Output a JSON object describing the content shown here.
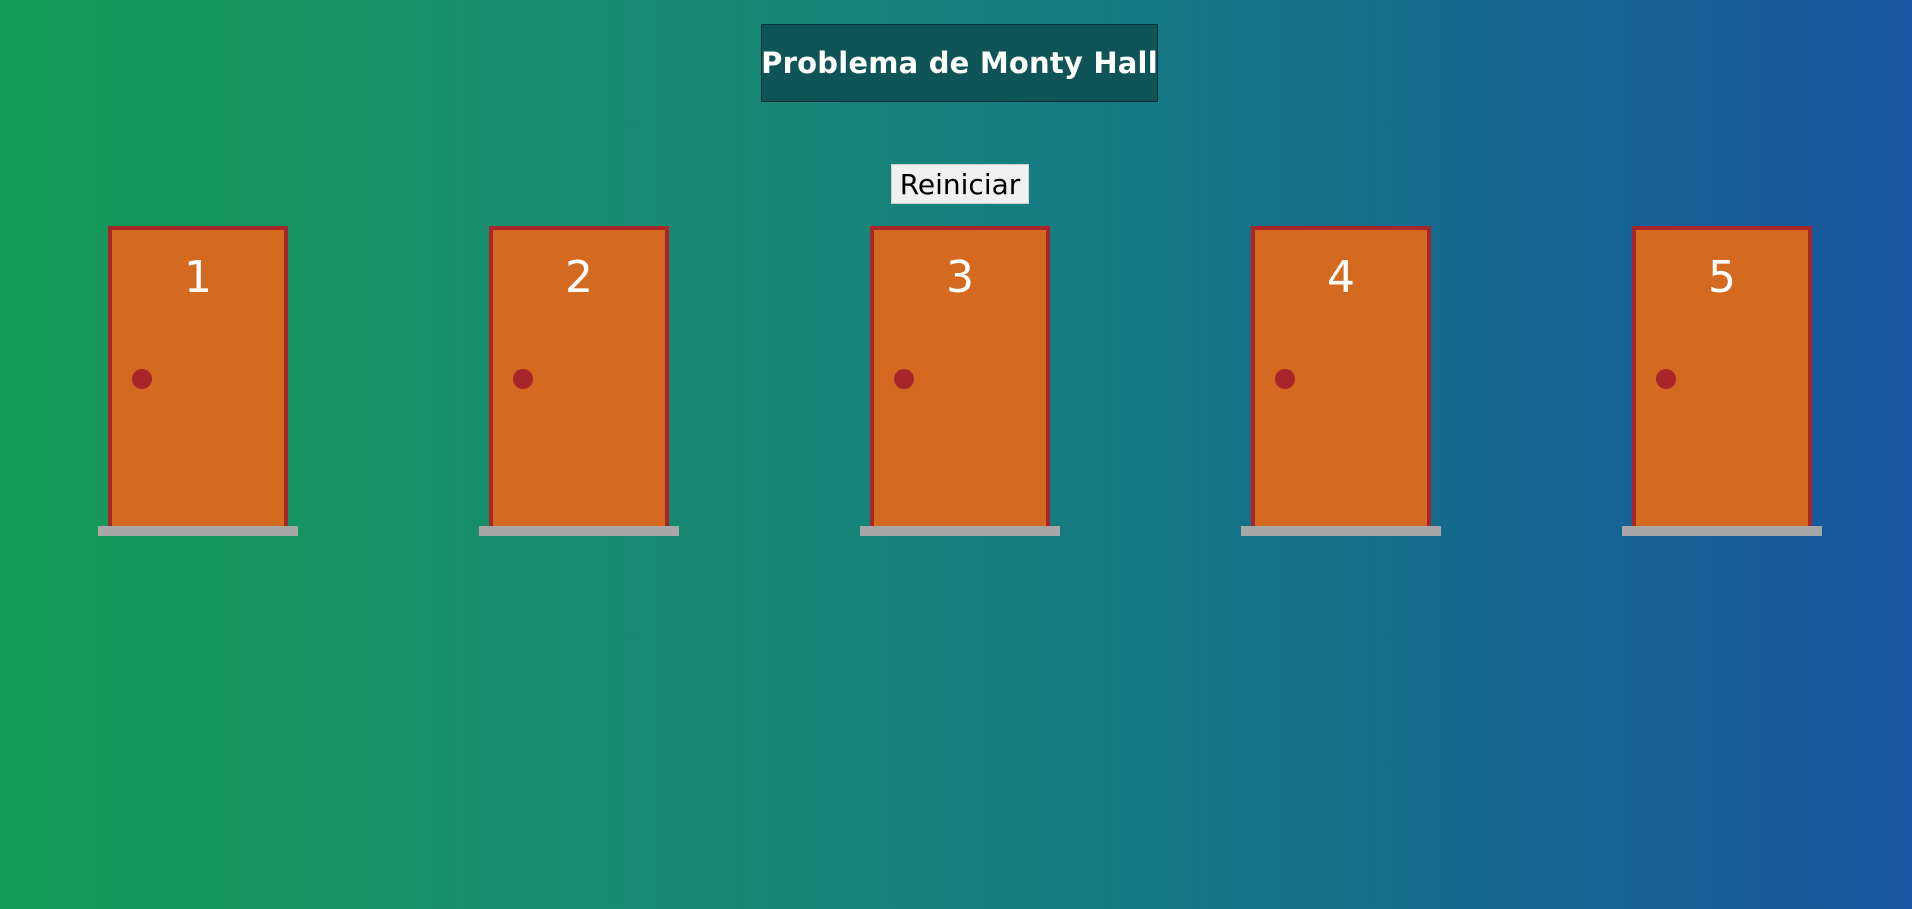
{
  "header": {
    "title": "Problema de Monty Hall"
  },
  "controls": {
    "restart_label": "Reiniciar"
  },
  "doors": [
    {
      "number": "1"
    },
    {
      "number": "2"
    },
    {
      "number": "3"
    },
    {
      "number": "4"
    },
    {
      "number": "5"
    }
  ],
  "colors": {
    "background_start": "#169b57",
    "background_end": "#1656a0",
    "title_box": "#0f5558",
    "door": "#d36a20",
    "door_frame": "#a8262a",
    "door_knob": "#a8262a",
    "door_sill": "#a7a7a7",
    "button": "#f0f0f0"
  },
  "icons": {
    "door_knob": "door-knob-icon"
  }
}
